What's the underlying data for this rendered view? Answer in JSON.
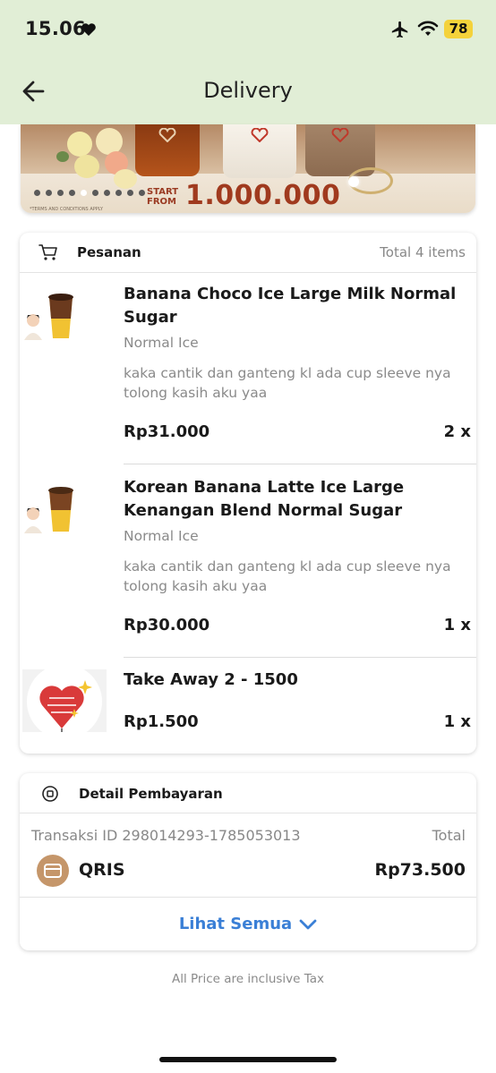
{
  "status_bar": {
    "time": "15.06",
    "battery": "78"
  },
  "header": {
    "title": "Delivery"
  },
  "banner": {
    "promo_start": "START\nFROM",
    "promo_amount": "1.000.000",
    "fine_print": "*TERMS AND CONDITIONS APPLY",
    "slide_count": 10,
    "active_slide": 4
  },
  "order": {
    "title": "Pesanan",
    "total_items": "Total 4 items",
    "items": [
      {
        "name": "Banana Choco Ice Large Milk Normal Sugar",
        "variant": "Normal Ice",
        "note": "kaka cantik dan ganteng kl ada cup sleeve nya tolong kasih aku yaa",
        "price": "Rp31.000",
        "qty": "2 x"
      },
      {
        "name": "Korean Banana Latte Ice Large Kenangan Blend Normal Sugar",
        "variant": "Normal Ice",
        "note": "kaka cantik dan ganteng kl ada cup sleeve nya tolong kasih aku yaa",
        "price": "Rp30.000",
        "qty": "1 x"
      },
      {
        "name": "Take Away 2 - 1500",
        "price": "Rp1.500",
        "qty": "1 x"
      }
    ]
  },
  "payment": {
    "title": "Detail Pembayaran",
    "transaction_id": "Transaksi ID 298014293-1785053013",
    "total_label": "Total",
    "method": "QRIS",
    "total_amount": "Rp73.500",
    "see_all": "Lihat Semua"
  },
  "footer": {
    "tax_note": "All Price are inclusive Tax"
  },
  "colors": {
    "header_bg": "#e1eed6",
    "link": "#3a7fd6",
    "qris_icon": "#c5966a",
    "battery": "#f4d23a"
  }
}
